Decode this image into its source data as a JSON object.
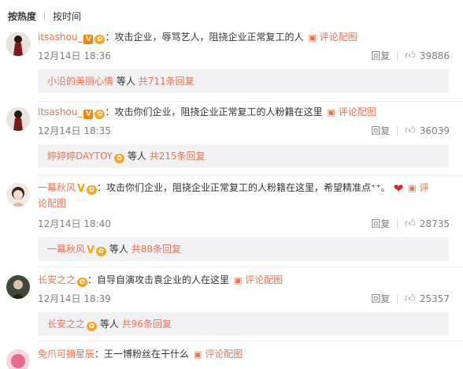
{
  "tabs": {
    "hot": "按热度",
    "time": "按时间"
  },
  "labels": {
    "reply": "回复",
    "pic": "评论配图",
    "others": "等人",
    "heart": "❤"
  },
  "comments": [
    {
      "user": "itsashou_",
      "text": "：攻击企业，辱骂艺人，阻挠企业正常复工的人",
      "time": "12月14日 18:36",
      "likes": "39886",
      "reply_user": "小沿的美丽心情",
      "reply_count": "共711条回复"
    },
    {
      "user": "itsashou_",
      "text": "：攻击你们企业，阻挠企业正常复工的人粉籍在这里",
      "time": "12月14日 18:35",
      "likes": "36039",
      "reply_user": "婷婷婷DAYTOY",
      "reply_count": "共215条回复"
    },
    {
      "user": "一幕秋风",
      "text": "：攻击你们企业，阻挠企业正常复工的人粉籍在这里，希望精准点⁺⁺。",
      "text2": "论配图",
      "time": "12月14日 18:40",
      "likes": "28735",
      "reply_user": "一幕秋风",
      "reply_count": "共88条回复"
    },
    {
      "user": "长安之之",
      "text": "：自导自演攻击袁企业的人在这里",
      "time": "12月14日 18:39",
      "likes": "25357",
      "reply_user": "长安之之",
      "reply_count": "共96条回复"
    },
    {
      "user": "兔爪可摘星辰",
      "text": "：王一博粉丝在干什么"
    }
  ],
  "colors": {
    "accent": "#eb7350",
    "meta": "#808080",
    "reply_bg": "#f2f2f5",
    "heart": "#e0242f"
  },
  "icons": {
    "like": "thumbs-up-icon",
    "pic": "image-icon",
    "vip": "vip-badge-icon",
    "club": "fan-club-badge-icon"
  }
}
